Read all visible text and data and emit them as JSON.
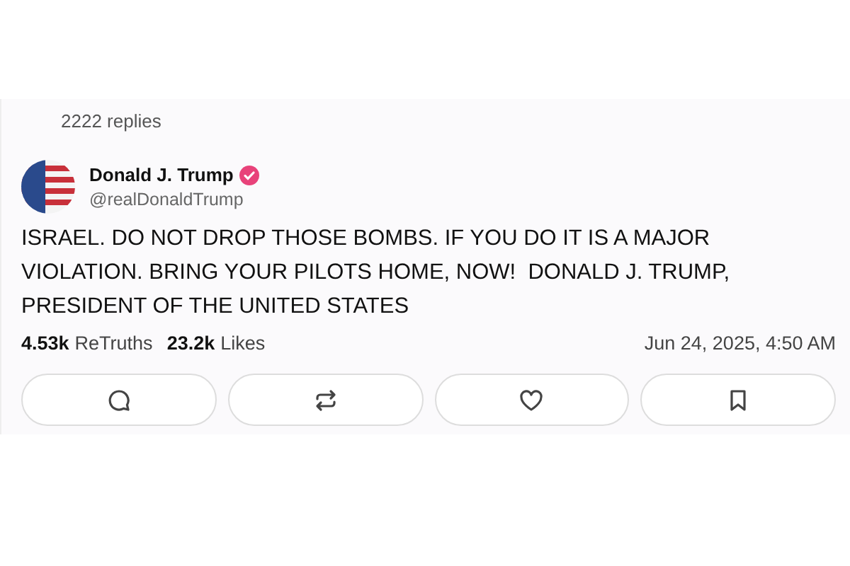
{
  "replies_count": "2222 replies",
  "author": {
    "name": "Donald J. Trump",
    "handle": "@realDonaldTrump",
    "verified": true
  },
  "post_text": "ISRAEL. DO NOT DROP THOSE BOMBS. IF YOU DO IT IS A MAJOR VIOLATION. BRING YOUR PILOTS HOME, NOW!  DONALD J. TRUMP, PRESIDENT OF THE UNITED STATES",
  "stats": [
    {
      "count": "4.53k",
      "label": "ReTruths"
    },
    {
      "count": "23.2k",
      "label": "Likes"
    }
  ],
  "timestamp": "Jun 24, 2025, 4:50 AM",
  "actions": [
    {
      "kind": "reply"
    },
    {
      "kind": "repost"
    },
    {
      "kind": "like"
    },
    {
      "kind": "bookmark"
    }
  ]
}
